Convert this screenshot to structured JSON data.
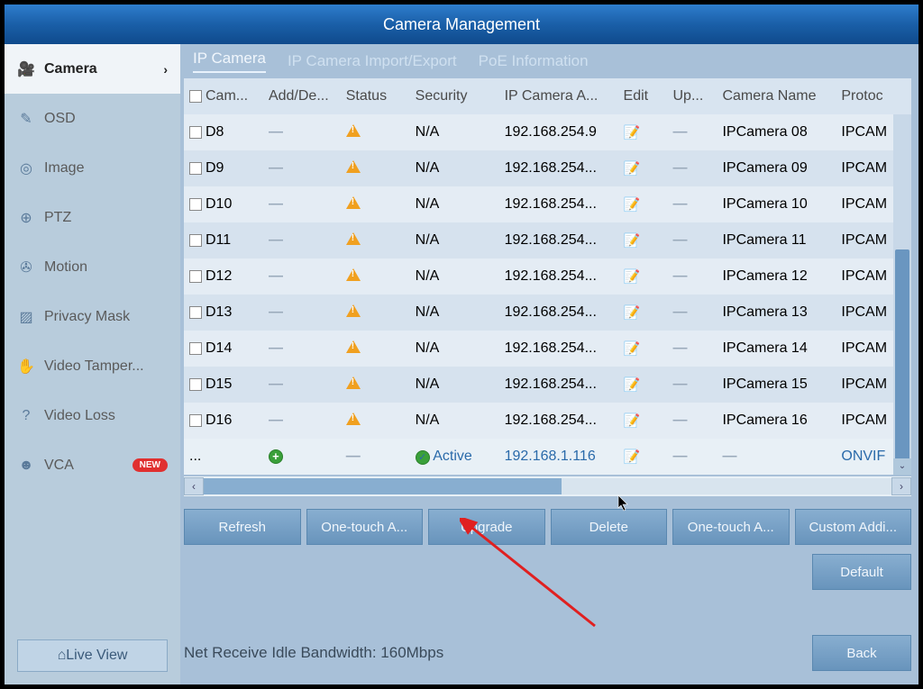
{
  "title": "Camera Management",
  "sidebar": [
    {
      "icon": "camera",
      "label": "Camera",
      "active": true,
      "chevron": true
    },
    {
      "icon": "osd",
      "label": "OSD"
    },
    {
      "icon": "image",
      "label": "Image"
    },
    {
      "icon": "ptz",
      "label": "PTZ"
    },
    {
      "icon": "motion",
      "label": "Motion"
    },
    {
      "icon": "privacy",
      "label": "Privacy Mask"
    },
    {
      "icon": "hand",
      "label": "Video Tamper..."
    },
    {
      "icon": "question",
      "label": "Video Loss"
    },
    {
      "icon": "vca",
      "label": "VCA",
      "badge": "NEW"
    }
  ],
  "live_view": "Live View",
  "tabs": [
    {
      "label": "IP Camera",
      "active": true
    },
    {
      "label": "IP Camera Import/Export"
    },
    {
      "label": "PoE Information"
    }
  ],
  "columns": [
    "Cam...",
    "Add/De...",
    "Status",
    "Security",
    "IP Camera A...",
    "Edit",
    "Up...",
    "Camera Name",
    "Protoc"
  ],
  "rows": [
    {
      "cam": "D8",
      "ip": "192.168.254.9",
      "name": "IPCamera 08",
      "proto": "IPCAM",
      "sec": "N/A"
    },
    {
      "cam": "D9",
      "ip": "192.168.254...",
      "name": "IPCamera 09",
      "proto": "IPCAM",
      "sec": "N/A"
    },
    {
      "cam": "D10",
      "ip": "192.168.254...",
      "name": "IPCamera 10",
      "proto": "IPCAM",
      "sec": "N/A"
    },
    {
      "cam": "D11",
      "ip": "192.168.254...",
      "name": "IPCamera 11",
      "proto": "IPCAM",
      "sec": "N/A"
    },
    {
      "cam": "D12",
      "ip": "192.168.254...",
      "name": "IPCamera 12",
      "proto": "IPCAM",
      "sec": "N/A"
    },
    {
      "cam": "D13",
      "ip": "192.168.254...",
      "name": "IPCamera 13",
      "proto": "IPCAM",
      "sec": "N/A"
    },
    {
      "cam": "D14",
      "ip": "192.168.254...",
      "name": "IPCamera 14",
      "proto": "IPCAM",
      "sec": "N/A"
    },
    {
      "cam": "D15",
      "ip": "192.168.254...",
      "name": "IPCamera 15",
      "proto": "IPCAM",
      "sec": "N/A"
    },
    {
      "cam": "D16",
      "ip": "192.168.254...",
      "name": "IPCamera 16",
      "proto": "IPCAM",
      "sec": "N/A"
    }
  ],
  "active_row": {
    "cam": "...",
    "sec": "Active",
    "ip": "192.168.1.116",
    "proto": "ONVIF"
  },
  "buttons": {
    "refresh": "Refresh",
    "onetouch_a": "One-touch A...",
    "upgrade": "Upgrade",
    "delete": "Delete",
    "onetouch_a2": "One-touch A...",
    "custom_add": "Custom Addi..."
  },
  "default_btn": "Default",
  "footer_text": "Net Receive Idle Bandwidth: 160Mbps",
  "back_btn": "Back"
}
